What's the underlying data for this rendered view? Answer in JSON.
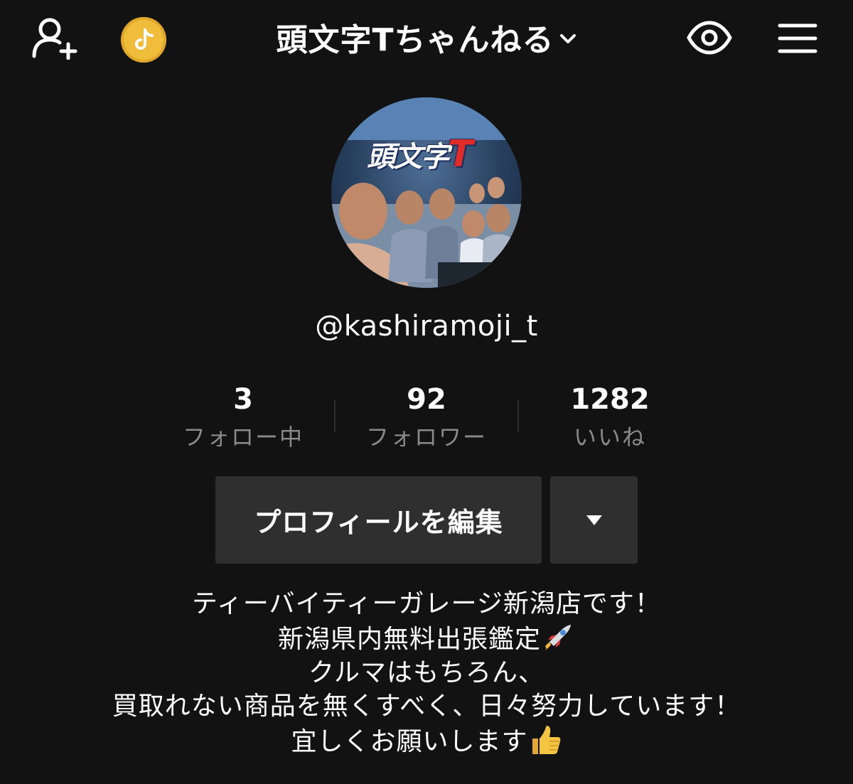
{
  "header": {
    "title": "頭文字Tちゃんねる",
    "icons": [
      "add-user-icon",
      "coin-icon",
      "chevron-down-icon",
      "eye-icon",
      "menu-icon"
    ]
  },
  "profile": {
    "avatar_logo_main": "頭文字",
    "avatar_logo_t": "T",
    "username": "@kashiramoji_t"
  },
  "stats": [
    {
      "value": "3",
      "label": "フォロー中"
    },
    {
      "value": "92",
      "label": "フォロワー"
    },
    {
      "value": "1282",
      "label": "いいね"
    }
  ],
  "buttons": {
    "edit_profile": "プロフィールを編集",
    "dropdown_icon": "triangle-down-icon"
  },
  "bio": {
    "line1": "ティーバイティーガレージ新潟店です！",
    "line2": "新潟県内無料出張鑑定",
    "line3": "クルマはもちろん、",
    "line4": "買取れない商品を無くすべく、日々努力しています！",
    "line5": "宜しくお願いします"
  },
  "colors": {
    "background": "#121212",
    "button_bg": "#2f2f2f",
    "label_gray": "#8a8a8a",
    "coin_gold": "#f0bd3a"
  }
}
